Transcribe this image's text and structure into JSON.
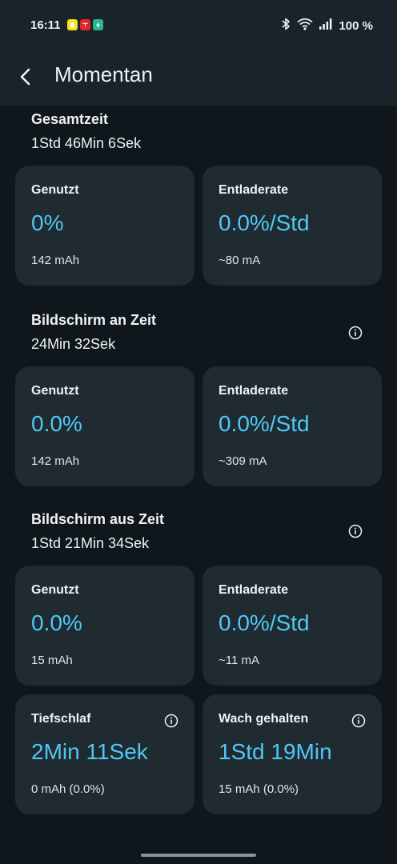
{
  "status_bar": {
    "time": "16:11",
    "battery": "100 %",
    "icons": [
      "snapchat-icon",
      "tesla-icon",
      "bolt-app-icon",
      "bluetooth-icon",
      "wifi-icon",
      "signal-icon"
    ]
  },
  "header": {
    "title": "Momentan",
    "back_icon": "back-arrow-icon"
  },
  "sections": {
    "total": {
      "title": "Gesamtzeit",
      "value": "1Std 46Min 6Sek",
      "used": {
        "label": "Genutzt",
        "value": "0%",
        "sub": "142 mAh"
      },
      "rate": {
        "label": "Entladerate",
        "value": "0.0%/Std",
        "sub": "~80 mA"
      }
    },
    "screen_on": {
      "title": "Bildschirm an Zeit",
      "value": "24Min 32Sek",
      "used": {
        "label": "Genutzt",
        "value": "0.0%",
        "sub": "142 mAh"
      },
      "rate": {
        "label": "Entladerate",
        "value": "0.0%/Std",
        "sub": "~309 mA"
      }
    },
    "screen_off": {
      "title": "Bildschirm aus Zeit",
      "value": "1Std 21Min 34Sek",
      "used": {
        "label": "Genutzt",
        "value": "0.0%",
        "sub": "15 mAh"
      },
      "rate": {
        "label": "Entladerate",
        "value": "0.0%/Std",
        "sub": "~11 mA"
      },
      "deep_sleep": {
        "label": "Tiefschlaf",
        "value": "2Min 11Sek",
        "sub": "0 mAh (0.0%)"
      },
      "kept_awake": {
        "label": "Wach gehalten",
        "value": "1Std 19Min",
        "sub": "15 mAh (0.0%)"
      }
    }
  },
  "colors": {
    "background": "#0f171c",
    "card": "#1f2a31",
    "accent": "#4fc8f5"
  }
}
